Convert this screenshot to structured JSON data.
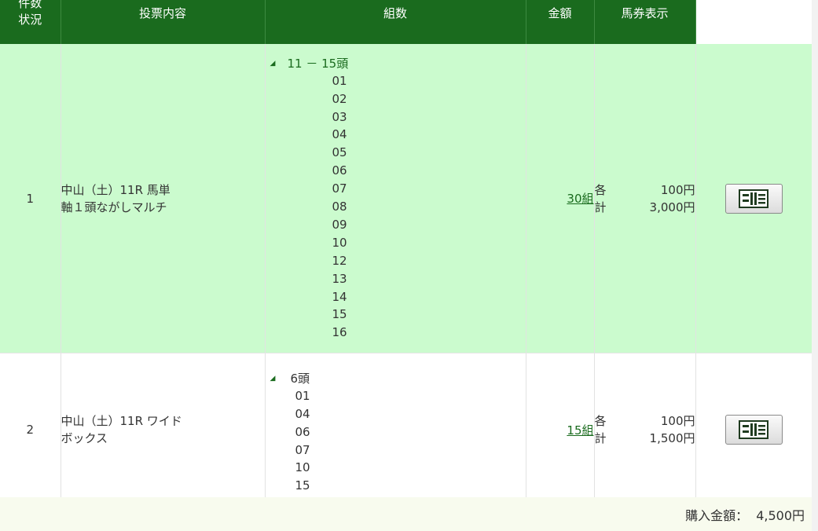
{
  "table": {
    "headers": {
      "count_status_line1": "件数",
      "count_status_line2": "状況",
      "content": "投票内容",
      "combos": "組数",
      "amount": "金額",
      "ticket": "馬券表示"
    },
    "rows": [
      {
        "index": "1",
        "desc_line1": "中山（土）11R 馬単",
        "desc_line2": "軸１頭ながしマルチ",
        "axis_label": "11 － 15頭",
        "horses": [
          "01",
          "02",
          "03",
          "04",
          "05",
          "06",
          "07",
          "08",
          "09",
          "10",
          "12",
          "13",
          "14",
          "15",
          "16"
        ],
        "combos": "30組",
        "each_label": "各",
        "each_value": "100円",
        "total_label": "計",
        "total_value": "3,000円"
      },
      {
        "index": "2",
        "desc_line1": "中山（土）11R ワイド",
        "desc_line2": "ボックス",
        "axis_label": "6頭",
        "horses": [
          "01",
          "04",
          "06",
          "07",
          "10",
          "15"
        ],
        "combos": "15組",
        "each_label": "各",
        "each_value": "100円",
        "total_label": "計",
        "total_value": "1,500円"
      }
    ]
  },
  "summary": {
    "label": "購入金額：",
    "value": "4,500円"
  },
  "icons": {
    "ticket": "ticket-icon"
  },
  "colors": {
    "header_bg": "#1a6b1e",
    "row_highlight": "#cbfbce",
    "link": "#1a6b1e"
  }
}
